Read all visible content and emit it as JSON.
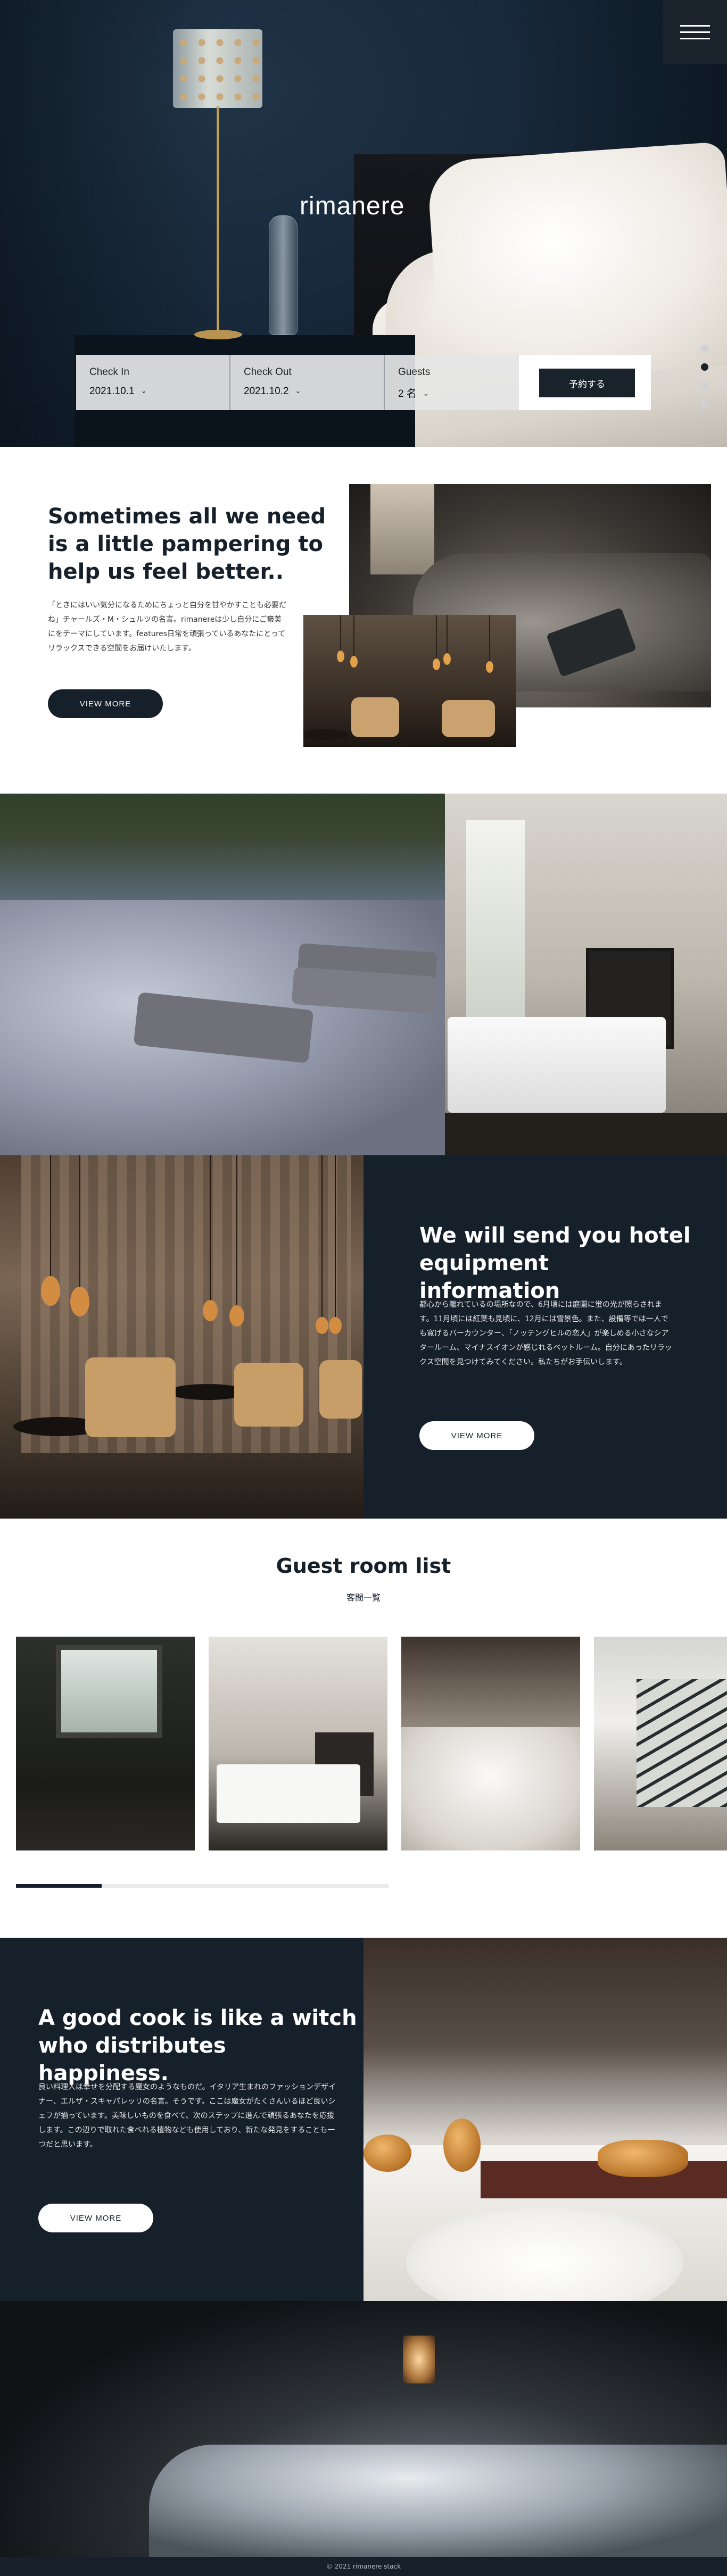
{
  "header": {
    "brand": "rimanere",
    "menu_icon": "hamburger-menu-icon"
  },
  "booking": {
    "check_in_label": "Check In",
    "check_in_value": "2021.10.1",
    "check_out_label": "Check Out",
    "check_out_value": "2021.10.2",
    "guests_label": "Guests",
    "guests_value": "2 名",
    "submit_label": "予約する"
  },
  "hero_slider": {
    "dot_count": 4,
    "active_index": 1
  },
  "intro": {
    "heading": "Sometimes all we need is a little pampering to help us feel better..",
    "body": "「ときにはいい気分になるためにちょっと自分を甘やかすことも必要だね」チャールズ・M・シュルツの名言。rimanereは少し自分にご褒美にをテーマにしています。features日常を頑張っているあなたにとってリラックスできる空間をお届けいたします。",
    "button_label": "VIEW MORE"
  },
  "equipment": {
    "heading": "We will send you hotel equipment information",
    "body": "都心から離れているの場所なので、6月頃には庭園に蛍の光が照らされます。11月頃には紅葉も見頃に、12月には雪景色。また、設備等では一人でも寛げるバーカウンター、「ノッテングヒルの恋人」が楽しめる小さなシアタールーム、マイナスイオンが感じれるベットルーム。自分にあったリラックス空間を見つけてみてください。私たちがお手伝いします。",
    "button_label": "VIEW MORE"
  },
  "rooms": {
    "title": "Guest room list",
    "subtitle": "客間一覧",
    "scroll_progress": 0.23
  },
  "cook": {
    "heading": "A good cook is like a witch who distributes happiness.",
    "body": "良い料理人は幸せを分配する魔女のようなものだ。イタリア生まれのファッションデザイナー、エルザ・スキャパレッリの名言。そうです。ここは魔女がたくさんいるほど良いシェフが揃っています。美味しいものを食べて、次のステップに進んで頑張るあなたを応援します。この辺りで取れた食べれる植物なども使用しており、新たな発見をすることも一つだと思います。",
    "button_label": "VIEW MORE"
  },
  "footer": {
    "copyright": "© 2021 rimanere stack"
  }
}
